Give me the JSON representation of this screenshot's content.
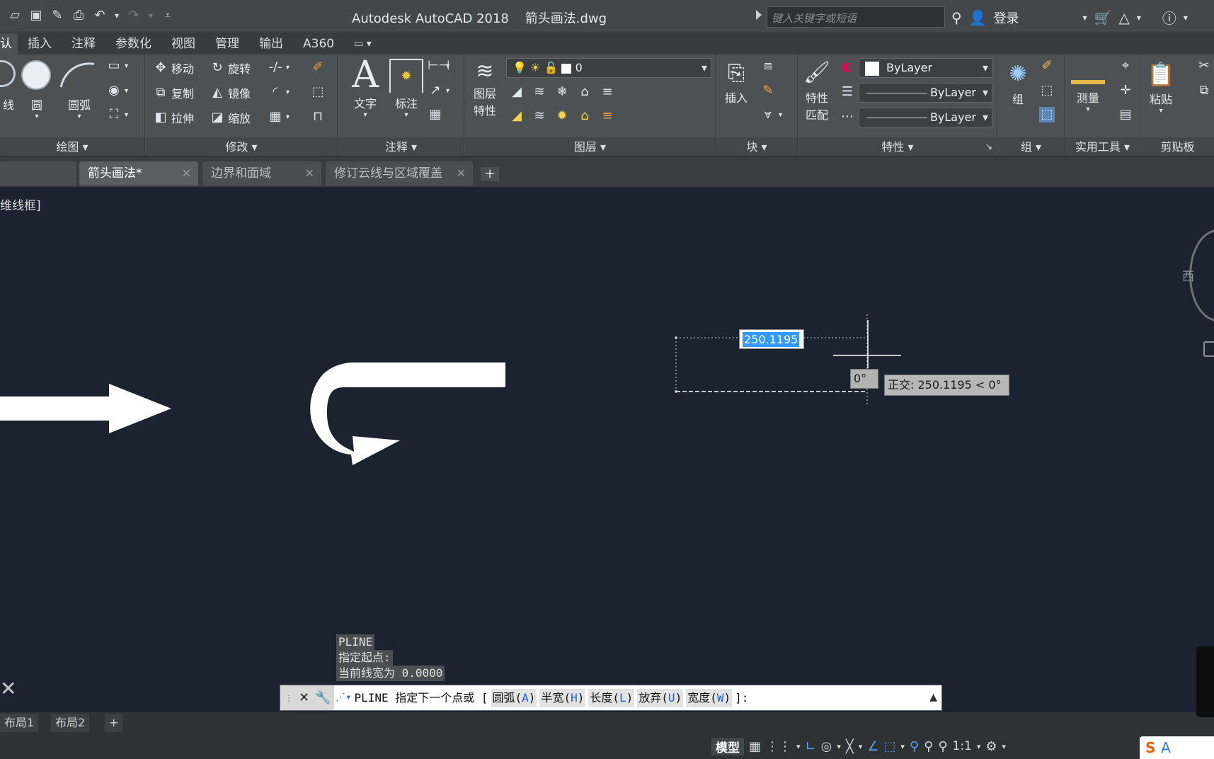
{
  "titlebar": {
    "app_title": "Autodesk AutoCAD 2018    箭头画法.dwg",
    "search_placeholder": "键入关键字或短语",
    "login": "登录"
  },
  "ribbon_tabs": [
    "认",
    "插入",
    "注释",
    "参数化",
    "视图",
    "管理",
    "输出",
    "A360"
  ],
  "draw_panel": {
    "title": "绘图",
    "line": "线",
    "circle": "圆",
    "arc": "圆弧"
  },
  "modify_panel": {
    "title": "修改",
    "move": "移动",
    "rotate": "旋转",
    "copy": "复制",
    "mirror": "镜像",
    "stretch": "拉伸",
    "scale": "缩放"
  },
  "annotation_panel": {
    "title": "注释",
    "text": "文字",
    "dimension": "标注"
  },
  "layers_panel": {
    "title": "图层",
    "layer_props_1": "图层",
    "layer_props_2": "特性",
    "current_layer": "0"
  },
  "block_panel": {
    "title": "块",
    "insert": "插入"
  },
  "properties_panel": {
    "title": "特性",
    "match_1": "特性",
    "match_2": "匹配",
    "color": "ByLayer",
    "linetype": "ByLayer",
    "lineweight": "ByLayer"
  },
  "group_panel": {
    "title": "组",
    "group": "组"
  },
  "utilities_panel": {
    "title": "实用工具",
    "measure": "测量"
  },
  "clipboard_panel": {
    "title": "剪贴板",
    "paste": "粘贴"
  },
  "file_tabs": [
    {
      "label": "箭头画法*"
    },
    {
      "label": "边界和面域"
    },
    {
      "label": "修订云线与区域覆盖"
    }
  ],
  "canvas": {
    "viewport_label": "维线框]",
    "viewcube_west": "西",
    "dynamic_input_value": "250.1195",
    "angle_tip": "0°",
    "ortho_tip": "正交: 250.1195 < 0°"
  },
  "history": [
    "PLINE",
    "指定起点:",
    "当前线宽为 0.0000"
  ],
  "command_line": {
    "prompt": "PLINE 指定下一个点或 [",
    "options": [
      {
        "label": "圆弧(",
        "key": "A",
        "end": ")"
      },
      {
        "label": "半宽(",
        "key": "H",
        "end": ")"
      },
      {
        "label": "长度(",
        "key": "L",
        "end": ")"
      },
      {
        "label": "放弃(",
        "key": "U",
        "end": ")"
      },
      {
        "label": "宽度(",
        "key": "W",
        "end": ")"
      }
    ],
    "suffix": "]:"
  },
  "layout_tabs": [
    "布局1",
    "布局2"
  ],
  "statusbar": {
    "model": "模型",
    "scale": "1:1"
  },
  "ime": {
    "logo": "S",
    "mode": "A"
  },
  "colors": {
    "canvas_bg": "#1b2330",
    "ribbon_bg": "#4d5153",
    "selection_blue": "#3399ff"
  }
}
